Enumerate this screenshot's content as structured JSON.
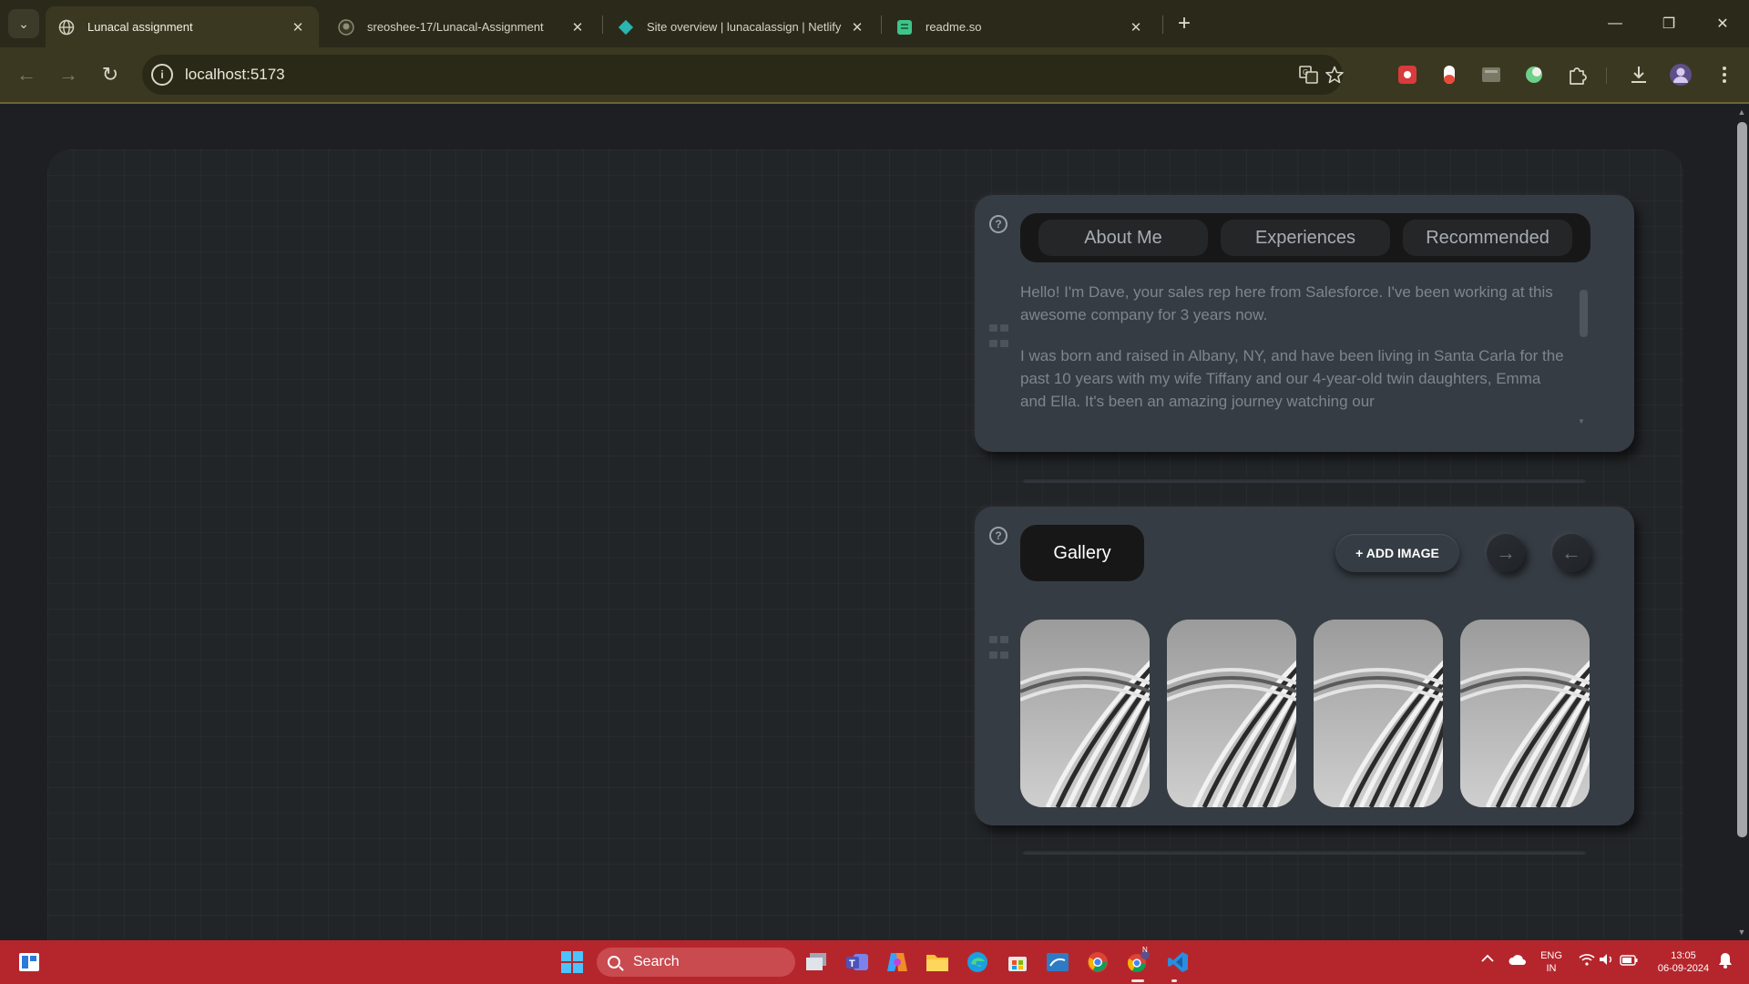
{
  "browser": {
    "tabs": [
      {
        "title": "Lunacal assignment",
        "icon": "globe-icon",
        "active": true
      },
      {
        "title": "sreoshee-17/Lunacal-Assignment",
        "icon": "github-icon",
        "active": false
      },
      {
        "title": "Site overview | lunacalassign | Netlify",
        "icon": "netlify-icon",
        "active": false
      },
      {
        "title": "readme.so",
        "icon": "readme-icon",
        "active": false
      }
    ],
    "url": "localhost:5173",
    "tab_search_glyph": "⌄",
    "new_tab_glyph": "+",
    "close_glyph": "✕",
    "window_controls": {
      "minimize": "—",
      "restore": "❐",
      "close": "✕"
    },
    "nav": {
      "back": "←",
      "forward": "→",
      "reload": "↻"
    }
  },
  "widgets": {
    "help_glyph": "?",
    "about": {
      "tabs": [
        "About Me",
        "Experiences",
        "Recommended"
      ],
      "paragraphs": [
        "Hello! I'm Dave, your sales rep here from Salesforce. I've been working at this awesome company for 3 years now.",
        "I was born and raised in Albany, NY, and have been living in Santa Carla for the past 10 years with my wife Tiffany and our 4-year-old twin daughters, Emma and Ella. It's been an amazing journey watching our"
      ]
    },
    "gallery": {
      "title": "Gallery",
      "add_button": "+ ADD IMAGE",
      "next_glyph": "→",
      "prev_glyph": "←",
      "image_count": 4
    }
  },
  "taskbar": {
    "search_placeholder": "Search",
    "language": "ENG",
    "region": "IN",
    "time": "13:05",
    "date": "06-09-2024",
    "badge": "N"
  },
  "colors": {
    "accent_taskbar": "#b5262c",
    "browser_frame": "#3a3820",
    "widget_bg": "#363c43"
  }
}
